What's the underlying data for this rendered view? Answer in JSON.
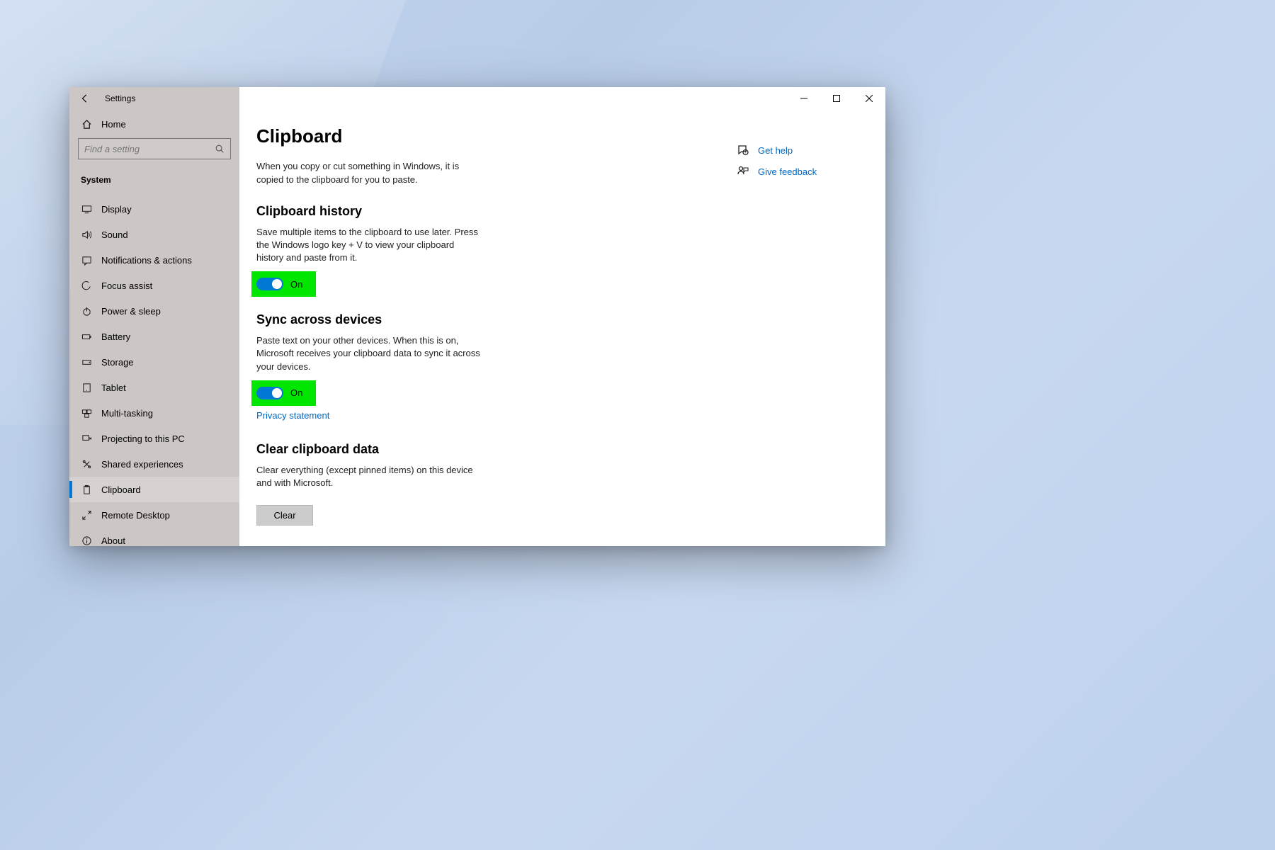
{
  "titlebar": {
    "title": "Settings"
  },
  "sidebar": {
    "home": "Home",
    "search_placeholder": "Find a setting",
    "category": "System",
    "items": [
      {
        "label": "Display"
      },
      {
        "label": "Sound"
      },
      {
        "label": "Notifications & actions"
      },
      {
        "label": "Focus assist"
      },
      {
        "label": "Power & sleep"
      },
      {
        "label": "Battery"
      },
      {
        "label": "Storage"
      },
      {
        "label": "Tablet"
      },
      {
        "label": "Multi-tasking"
      },
      {
        "label": "Projecting to this PC"
      },
      {
        "label": "Shared experiences"
      },
      {
        "label": "Clipboard"
      },
      {
        "label": "Remote Desktop"
      },
      {
        "label": "About"
      }
    ]
  },
  "main": {
    "title": "Clipboard",
    "intro": "When you copy or cut something in Windows, it is copied to the clipboard for you to paste.",
    "history": {
      "heading": "Clipboard history",
      "desc": "Save multiple items to the clipboard to use later. Press the Windows logo key + V to view your clipboard history and paste from it.",
      "state": "On"
    },
    "sync": {
      "heading": "Sync across devices",
      "desc": "Paste text on your other devices. When this is on, Microsoft receives your clipboard data to sync it across your devices.",
      "state": "On",
      "privacy_link": "Privacy statement"
    },
    "clear": {
      "heading": "Clear clipboard data",
      "desc": "Clear everything (except pinned items) on this device and with Microsoft.",
      "button": "Clear"
    }
  },
  "aside": {
    "help": "Get help",
    "feedback": "Give feedback"
  }
}
